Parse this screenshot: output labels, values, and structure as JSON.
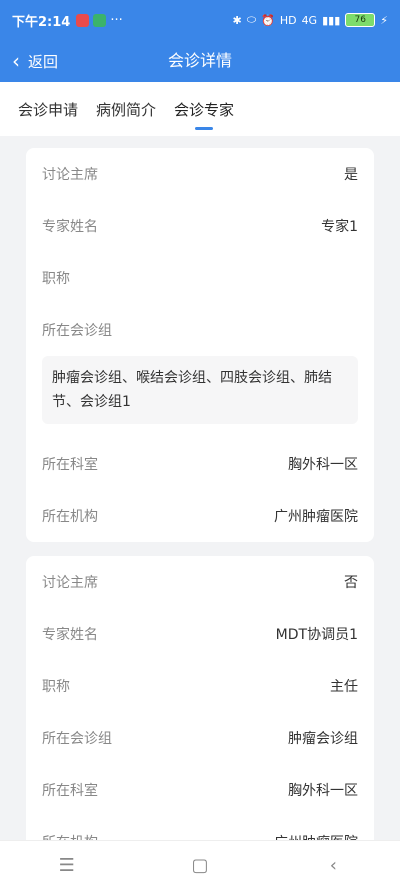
{
  "status_bar": {
    "time": "下午2:14",
    "dots": "···",
    "network": "4G",
    "hd": "HD",
    "battery": "76"
  },
  "nav": {
    "back_label": "返回",
    "title": "会诊详情"
  },
  "tabs": [
    {
      "label": "会诊申请"
    },
    {
      "label": "病例简介"
    },
    {
      "label": "会诊专家"
    }
  ],
  "experts": [
    {
      "chair_label": "讨论主席",
      "chair_value": "是",
      "name_label": "专家姓名",
      "name_value": "专家1",
      "title_label": "职称",
      "title_value": "",
      "group_label": "所在会诊组",
      "group_value": "肿瘤会诊组、喉结会诊组、四肢会诊组、肺结节、会诊组1",
      "dept_label": "所在科室",
      "dept_value": "胸外科一区",
      "org_label": "所在机构",
      "org_value": "广州肿瘤医院"
    },
    {
      "chair_label": "讨论主席",
      "chair_value": "否",
      "name_label": "专家姓名",
      "name_value": "MDT协调员1",
      "title_label": "职称",
      "title_value": "主任",
      "group_label": "所在会诊组",
      "group_value": "肿瘤会诊组",
      "dept_label": "所在科室",
      "dept_value": "胸外科一区",
      "org_label": "所在机构",
      "org_value": "广州肿瘤医院"
    }
  ],
  "colors": {
    "header": "#3a86e8",
    "tab_indicator": "#3a86e8"
  }
}
